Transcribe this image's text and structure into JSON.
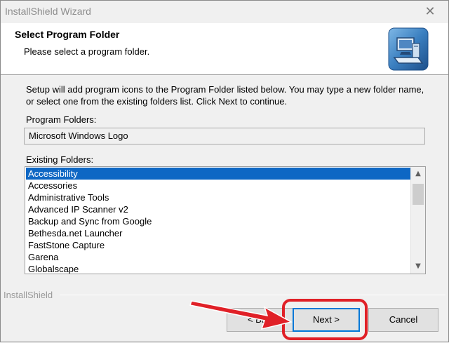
{
  "window": {
    "title": "InstallShield Wizard",
    "close_glyph": "✕"
  },
  "header": {
    "title": "Select Program Folder",
    "subtitle": "Please select a program folder.",
    "icon": "installer-computer-icon"
  },
  "main": {
    "description": "Setup will add program icons to the Program Folder listed below.  You may type a new folder name, or select one from the existing folders list.  Click Next to continue.",
    "program_folders_label": "Program Folders:",
    "program_folder_value": "Microsoft Windows Logo",
    "existing_folders_label": "Existing Folders:",
    "existing_folders": [
      "Accessibility",
      "Accessories",
      "Administrative Tools",
      "Advanced IP Scanner v2",
      "Backup and Sync from Google",
      "Bethesda.net Launcher",
      "FastStone Capture",
      "Garena",
      "Globalscape"
    ],
    "selected_index": 0
  },
  "footer": {
    "brand": "InstallShield",
    "back_label": "< Back",
    "next_label": "Next >",
    "cancel_label": "Cancel"
  },
  "colors": {
    "selection": "#0e67c4",
    "highlight": "#e02027",
    "default_button_border": "#0078d7"
  }
}
